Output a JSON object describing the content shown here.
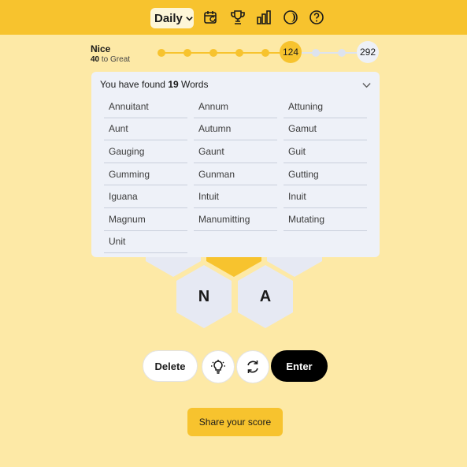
{
  "header": {
    "mode_label": "Daily",
    "icons": [
      "calendar-refresh-icon",
      "trophy-icon",
      "bar-chart-icon",
      "theme-icon",
      "help-icon"
    ]
  },
  "rank": {
    "name": "Nice",
    "points_to_next": "40",
    "next_rank_text": "to Great",
    "score": "124",
    "max_score": "292"
  },
  "found": {
    "prefix": "You have found",
    "count": "19",
    "suffix": "Words",
    "words": [
      "Annuitant",
      "Annum",
      "Attuning",
      "Aunt",
      "Autumn",
      "Gamut",
      "Gauging",
      "Gaunt",
      "Guit",
      "Gumming",
      "Gunman",
      "Gutting",
      "Iguana",
      "Intuit",
      "Inuit",
      "Magnum",
      "Manumitting",
      "Mutating",
      "Unit"
    ]
  },
  "hive": {
    "letters": [
      "N",
      "A"
    ]
  },
  "actions": {
    "delete_label": "Delete",
    "enter_label": "Enter",
    "share_label": "Share your score"
  },
  "colors": {
    "accent": "#f7c32e",
    "background": "#fde9a6",
    "panel": "#eef1f8"
  }
}
